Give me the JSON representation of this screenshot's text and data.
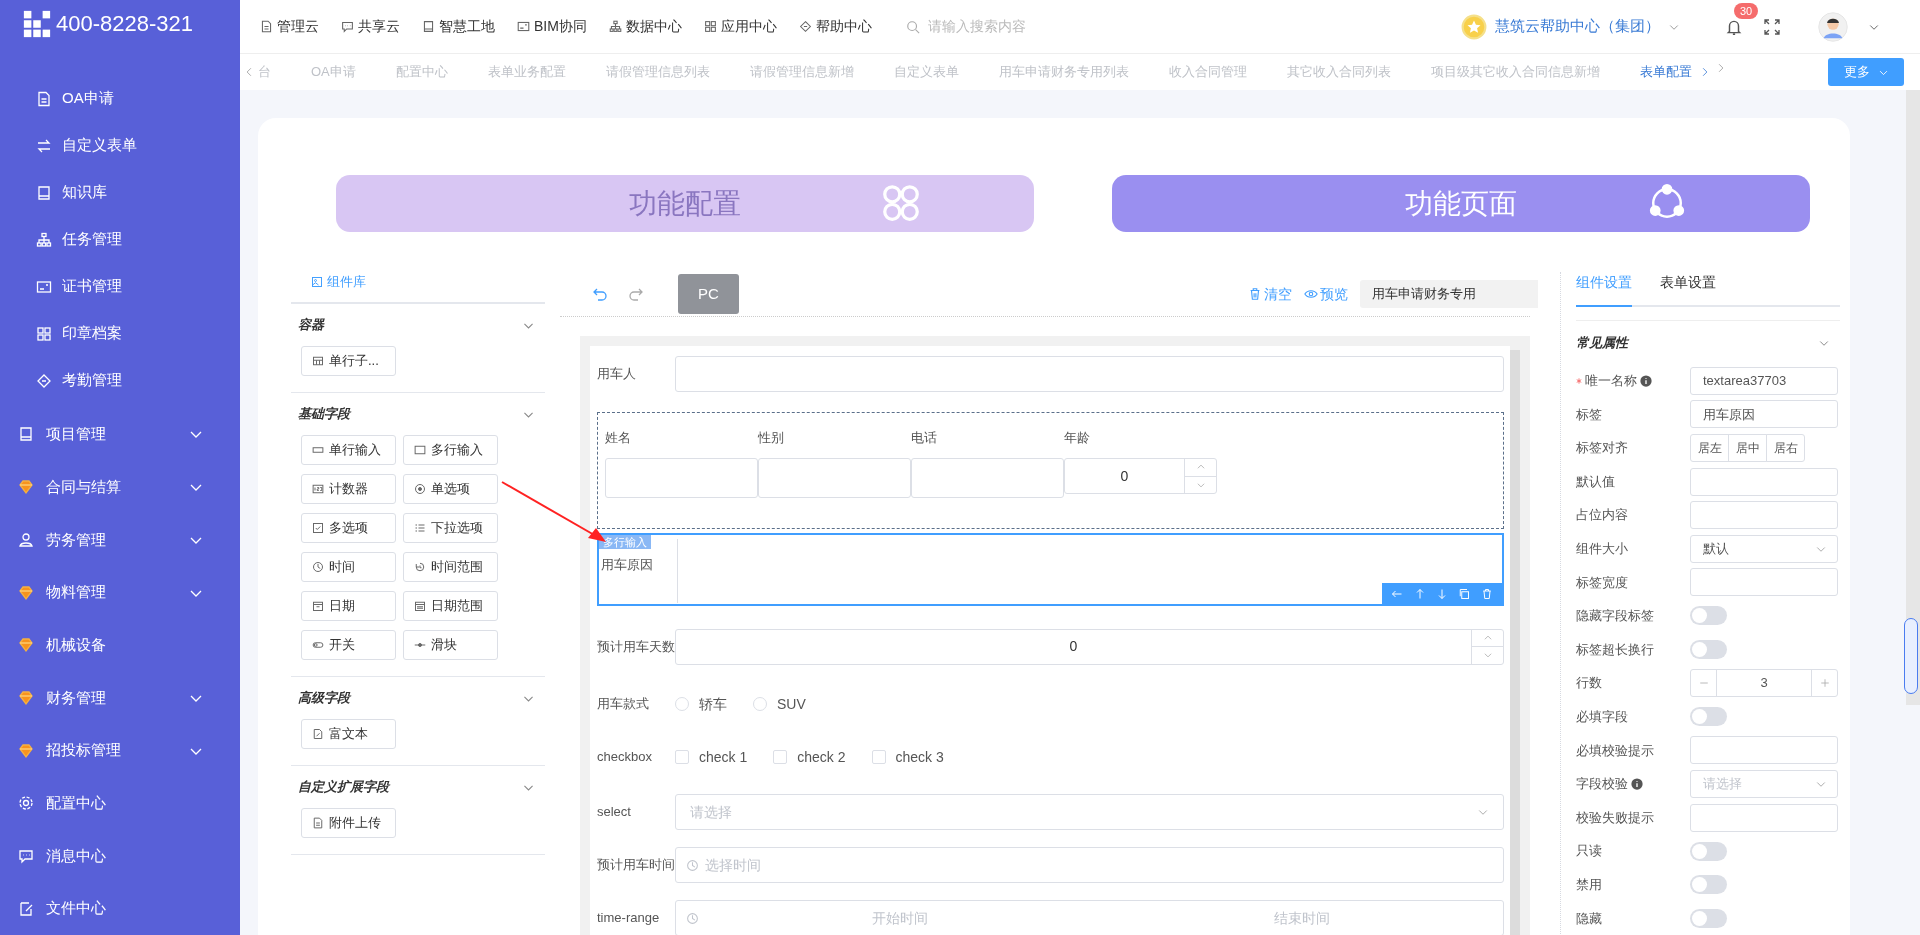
{
  "sidebar": {
    "logo_text": "400-8228-321",
    "items": [
      {
        "label": "OA申请",
        "kind": "sub"
      },
      {
        "label": "自定义表单",
        "kind": "sub"
      },
      {
        "label": "知识库",
        "kind": "sub"
      },
      {
        "label": "任务管理",
        "kind": "sub"
      },
      {
        "label": "证书管理",
        "kind": "sub"
      },
      {
        "label": "印章档案",
        "kind": "sub"
      },
      {
        "label": "考勤管理",
        "kind": "sub"
      },
      {
        "label": "项目管理",
        "kind": "menu"
      },
      {
        "label": "合同与结算",
        "kind": "menu"
      },
      {
        "label": "劳务管理",
        "kind": "menu"
      },
      {
        "label": "物料管理",
        "kind": "menu"
      },
      {
        "label": "机械设备",
        "kind": "link"
      },
      {
        "label": "财务管理",
        "kind": "menu"
      },
      {
        "label": "招投标管理",
        "kind": "menu"
      },
      {
        "label": "配置中心",
        "kind": "link"
      },
      {
        "label": "消息中心",
        "kind": "link"
      },
      {
        "label": "文件中心",
        "kind": "link"
      }
    ]
  },
  "top_nav": [
    "管理云",
    "共享云",
    "智慧工地",
    "BIM协同",
    "数据中心",
    "应用中心",
    "帮助中心"
  ],
  "search": {
    "placeholder": "请输入搜索内容"
  },
  "organization": "慧筑云帮助中心（集团）",
  "notifications": "30",
  "tabs": [
    {
      "label": "台",
      "selected": false
    },
    {
      "label": "OA申请",
      "selected": false
    },
    {
      "label": "配置中心",
      "selected": false
    },
    {
      "label": "表单业务配置",
      "selected": false
    },
    {
      "label": "请假管理信息列表",
      "selected": false
    },
    {
      "label": "请假管理信息新增",
      "selected": false
    },
    {
      "label": "自定义表单",
      "selected": false
    },
    {
      "label": "用车申请财务专用列表",
      "selected": false
    },
    {
      "label": "收入合同管理",
      "selected": false
    },
    {
      "label": "其它收入合同列表",
      "selected": false
    },
    {
      "label": "项目级其它收入合同信息新增",
      "selected": false
    },
    {
      "label": "表单配置",
      "selected": true
    }
  ],
  "more_button": "更多",
  "banners": [
    {
      "label": "功能配置",
      "selected": false
    },
    {
      "label": "功能页面",
      "selected": true
    }
  ],
  "component_library": {
    "title": "组件库",
    "sections": [
      {
        "title": "容器",
        "expanded": true,
        "items": [
          "单行子..."
        ]
      },
      {
        "title": "基础字段",
        "expanded": true,
        "items": [
          "单行输入",
          "多行输入",
          "计数器",
          "单选项",
          "多选项",
          "下拉选项",
          "时间",
          "时间范围",
          "日期",
          "日期范围",
          "开关",
          "滑块"
        ]
      },
      {
        "title": "高级字段",
        "expanded": true,
        "items": [
          "富文本"
        ]
      },
      {
        "title": "自定义扩展字段",
        "expanded": true,
        "items": [
          "附件上传"
        ]
      }
    ]
  },
  "designer": {
    "device": "PC",
    "actions": [
      "清空",
      "预览"
    ],
    "form_name": "用车申请财务专用",
    "fields": [
      {
        "kind": "input",
        "label": "用车人",
        "selected": false
      },
      {
        "kind": "grid",
        "selected": false,
        "columns": [
          {
            "kind": "input",
            "label": "姓名"
          },
          {
            "kind": "input",
            "label": "性别"
          },
          {
            "kind": "input",
            "label": "电话"
          },
          {
            "kind": "number",
            "label": "年龄",
            "value": "0"
          }
        ]
      },
      {
        "kind": "textarea",
        "label": "用车原因",
        "selected": true,
        "tag": "多行输入"
      },
      {
        "kind": "number",
        "label": "预计用车天数",
        "value": "0",
        "selected": false
      },
      {
        "kind": "radio",
        "label": "用车款式",
        "selected": false,
        "options": [
          {
            "label": "轿车",
            "checked": false
          },
          {
            "label": "SUV",
            "checked": false
          }
        ]
      },
      {
        "kind": "checkbox",
        "label": "checkbox",
        "selected": false,
        "options": [
          {
            "label": "check 1",
            "checked": false
          },
          {
            "label": "check 2",
            "checked": false
          },
          {
            "label": "check 3",
            "checked": false
          }
        ]
      },
      {
        "kind": "select",
        "label": "select",
        "placeholder": "请选择",
        "selected": false
      },
      {
        "kind": "time",
        "label": "预计用车时间",
        "placeholder": "选择时间",
        "selected": false
      },
      {
        "kind": "time-range",
        "label": "time-range",
        "start": "开始时间",
        "end": "结束时间",
        "selected": false
      }
    ]
  },
  "settings": {
    "tabs": [
      {
        "label": "组件设置",
        "selected": true
      },
      {
        "label": "表单设置",
        "selected": false
      }
    ],
    "section": {
      "title": "常见属性",
      "expanded": true
    },
    "properties": [
      {
        "label": "唯一名称",
        "required": true,
        "info": true,
        "kind": "input",
        "value": "textarea37703"
      },
      {
        "label": "标签",
        "required": false,
        "info": false,
        "kind": "input",
        "value": "用车原因"
      },
      {
        "label": "标签对齐",
        "required": false,
        "info": false,
        "kind": "segmented",
        "options": [
          {
            "label": "居左",
            "selected": false
          },
          {
            "label": "居中",
            "selected": false
          },
          {
            "label": "居右",
            "selected": false
          }
        ]
      },
      {
        "label": "默认值",
        "required": false,
        "info": false,
        "kind": "input"
      },
      {
        "label": "占位内容",
        "required": false,
        "info": false,
        "kind": "input"
      },
      {
        "label": "组件大小",
        "required": false,
        "info": false,
        "kind": "select",
        "value": "默认"
      },
      {
        "label": "标签宽度",
        "required": false,
        "info": false,
        "kind": "input"
      },
      {
        "label": "隐藏字段标签",
        "required": false,
        "info": false,
        "kind": "switch",
        "on": false
      },
      {
        "label": "标签超长换行",
        "required": false,
        "info": false,
        "kind": "switch",
        "on": false
      },
      {
        "label": "行数",
        "required": false,
        "info": false,
        "kind": "stepper",
        "value": "3"
      },
      {
        "label": "必填字段",
        "required": false,
        "info": false,
        "kind": "switch",
        "on": false
      },
      {
        "label": "必填校验提示",
        "required": false,
        "info": false,
        "kind": "input"
      },
      {
        "label": "字段校验",
        "required": false,
        "info": true,
        "kind": "select",
        "placeholder": "请选择"
      },
      {
        "label": "校验失败提示",
        "required": false,
        "info": false,
        "kind": "input"
      },
      {
        "label": "只读",
        "required": false,
        "info": false,
        "kind": "switch",
        "on": false
      },
      {
        "label": "禁用",
        "required": false,
        "info": false,
        "kind": "switch",
        "on": false
      },
      {
        "label": "隐藏",
        "required": false,
        "info": false,
        "kind": "switch",
        "on": false
      }
    ]
  }
}
